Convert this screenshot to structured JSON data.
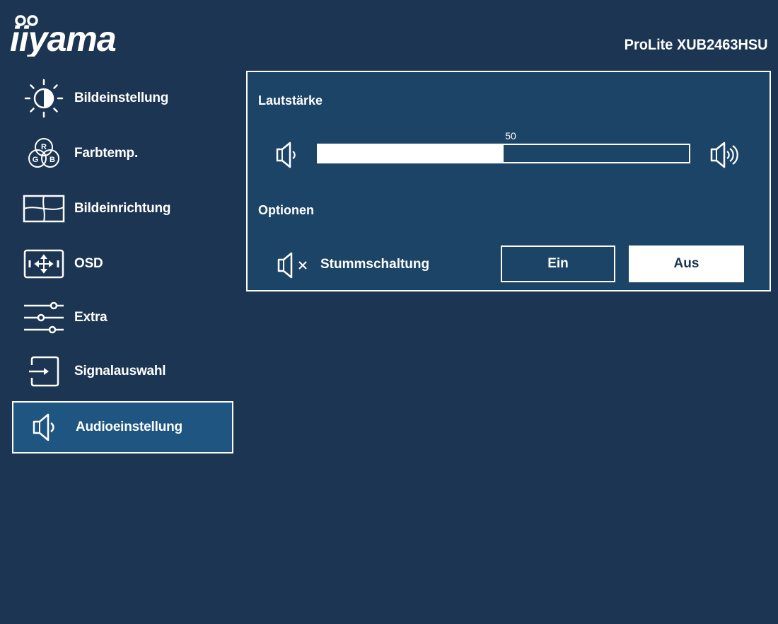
{
  "brand": {
    "logo_text": "iiyama",
    "model": "ProLite XUB2463HSU"
  },
  "colors": {
    "background": "#1b3552",
    "panel": "#1c4466",
    "active_item": "#1e5581",
    "foreground": "#ffffff"
  },
  "sidebar": {
    "items": [
      {
        "label": "Bildeinstellung",
        "icon": "brightness-contrast-icon"
      },
      {
        "label": "Farbtemp.",
        "icon": "rgb-color-icon"
      },
      {
        "label": "Bildeinrichtung",
        "icon": "image-setup-icon"
      },
      {
        "label": "OSD",
        "icon": "osd-position-icon"
      },
      {
        "label": "Extra",
        "icon": "sliders-icon"
      },
      {
        "label": "Signalauswahl",
        "icon": "input-source-icon"
      },
      {
        "label": "Audioeinstellung",
        "icon": "speaker-icon",
        "active": true
      }
    ]
  },
  "rgb_letters": [
    "R",
    "G",
    "B"
  ],
  "audio": {
    "volume_title": "Lautstärke",
    "volume_value": "50",
    "volume_fraction": 0.5,
    "options_title": "Optionen",
    "mute_label": "Stummschaltung",
    "mute_options": [
      "Ein",
      "Aus"
    ],
    "mute_selected": "Aus"
  }
}
